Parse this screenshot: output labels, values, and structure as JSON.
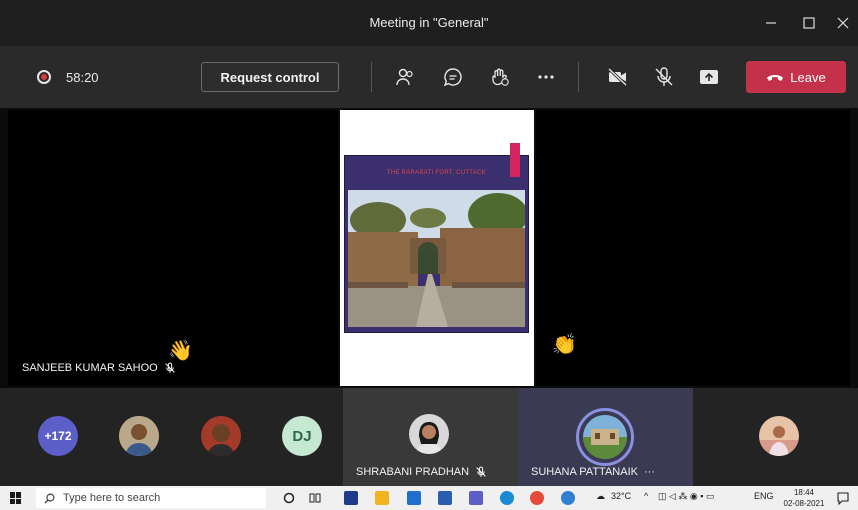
{
  "window": {
    "title": "Meeting in \"General\""
  },
  "toolbar": {
    "recording_time": "58:20",
    "request_control_label": "Request control",
    "leave_label": "Leave",
    "colors": {
      "leave": "#c4314b",
      "recording": "#e0383e"
    },
    "icons": [
      "participants-icon",
      "chat-icon",
      "raise-hand-icon",
      "more-options-icon",
      "camera-off-icon",
      "mic-off-icon",
      "share-tray-icon",
      "phone-hangup-icon"
    ]
  },
  "stage": {
    "left_participant": {
      "name": "SANJEEB KUMAR SAHOO",
      "muted": true,
      "hand_raised": true
    },
    "right_participant": {
      "hand_raised": true
    },
    "shared_slide": {
      "title": "THE BARABATI FORT, CUTTACK"
    }
  },
  "strip": {
    "overflow_count": "+172",
    "dj_initials": "DJ",
    "participants": [
      {
        "name": "SHRABANI PRADHAN",
        "muted": true
      },
      {
        "name": "SUHANA PATTANAIK",
        "more": "···",
        "speaking": true
      }
    ],
    "colors": {
      "overflow": "#5b5fc7",
      "dj_bg": "#c6e8d2",
      "speaking_ring": "#8a8fe0"
    }
  },
  "taskbar": {
    "search_placeholder": "Type here to search",
    "temperature": "32°C",
    "language": "ENG",
    "time": "18:44",
    "date": "02-08-2021"
  }
}
